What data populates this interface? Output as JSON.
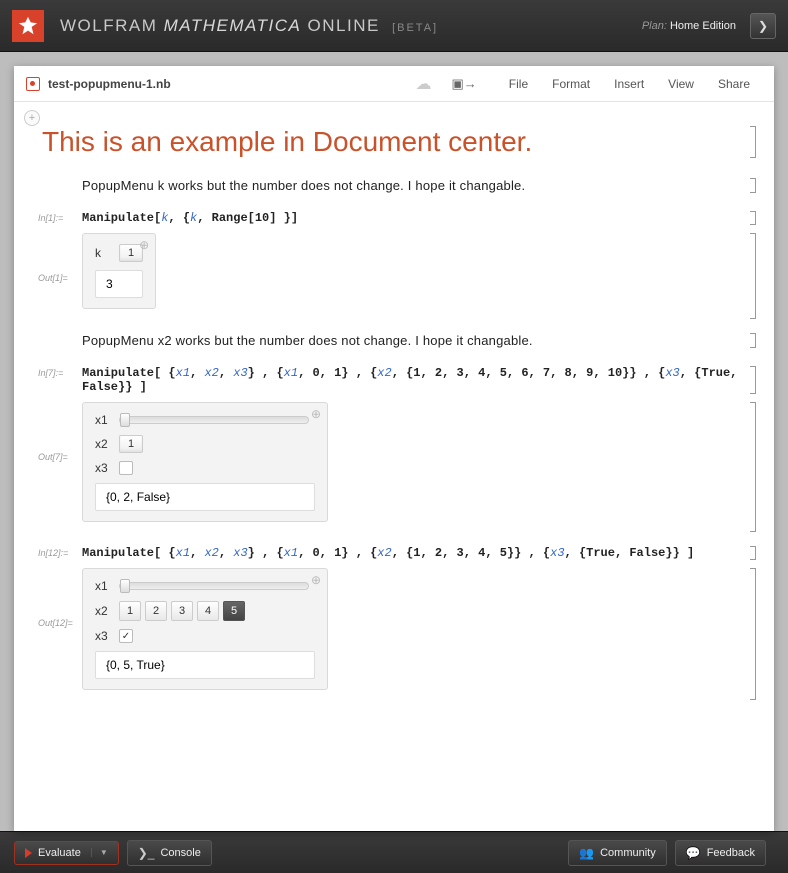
{
  "topbar": {
    "brand_prefix": "WOLFRAM ",
    "brand_em": "MATHEMATICA",
    "brand_suffix": " ONLINE",
    "beta": "[BETA]",
    "plan_label": "Plan: ",
    "plan_value": "Home Edition"
  },
  "toolbar": {
    "filename": "test-popupmenu-1.nb",
    "menus": [
      "File",
      "Format",
      "Insert",
      "View",
      "Share"
    ]
  },
  "title": "This is an example in Document center.",
  "text1": "PopupMenu k works but the number does not change. I hope it changable.",
  "cell1": {
    "in_label": "In[1]:=",
    "out_label": "Out[1]=",
    "ctrl_label": "k",
    "popup_value": "1",
    "result": "3"
  },
  "text2": "PopupMenu x2 works but the number does not change. I hope it changable.",
  "cell2": {
    "in_label": "In[7]:=",
    "out_label": "Out[7]=",
    "x1_label": "x1",
    "x2_label": "x2",
    "x3_label": "x3",
    "x2_value": "1",
    "result": "{0, 2, False}"
  },
  "cell3": {
    "in_label": "In[12]:=",
    "out_label": "Out[12]=",
    "x1_label": "x1",
    "x2_label": "x2",
    "x3_label": "x3",
    "setters": [
      "1",
      "2",
      "3",
      "4",
      "5"
    ],
    "active_idx": 4,
    "result": "{0, 5, True}"
  },
  "bottombar": {
    "evaluate": "Evaluate",
    "console": "Console",
    "community": "Community",
    "feedback": "Feedback"
  }
}
